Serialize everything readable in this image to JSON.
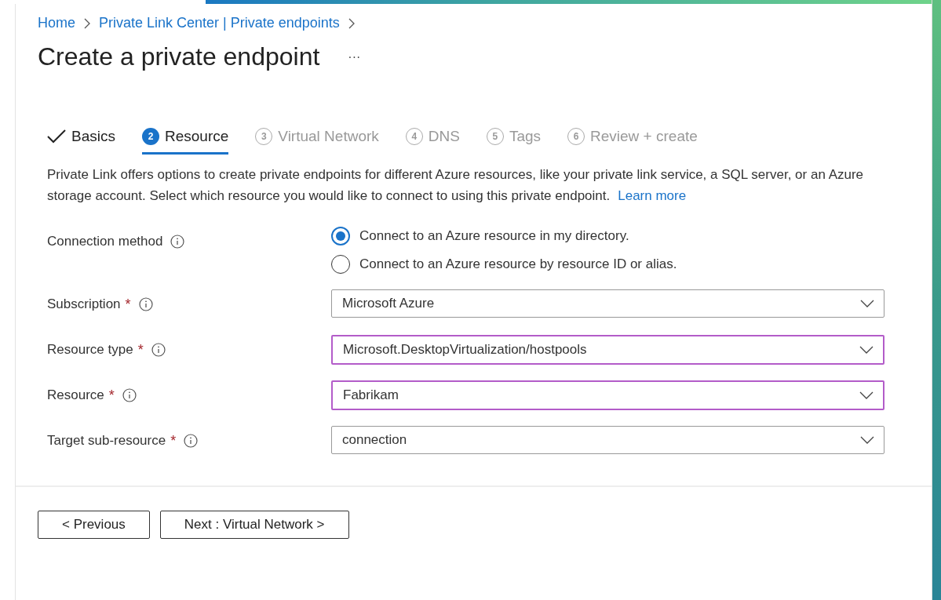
{
  "breadcrumb": [
    {
      "label": "Home"
    },
    {
      "label": "Private Link Center | Private endpoints"
    }
  ],
  "title": "Create a private endpoint",
  "more": "···",
  "tabs": [
    {
      "label": "Basics",
      "completed": true,
      "selected": false
    },
    {
      "number": "2",
      "label": "Resource",
      "completed": false,
      "selected": true
    },
    {
      "number": "3",
      "label": "Virtual Network",
      "completed": false,
      "selected": false
    },
    {
      "number": "4",
      "label": "DNS",
      "completed": false,
      "selected": false
    },
    {
      "number": "5",
      "label": "Tags",
      "completed": false,
      "selected": false
    },
    {
      "number": "6",
      "label": "Review + create",
      "completed": false,
      "selected": false
    }
  ],
  "description": "Private Link offers options to create private endpoints for different Azure resources, like your private link service, a SQL server, or an Azure storage account. Select which resource you would like to connect to using this private endpoint.",
  "learn_more": "Learn more",
  "connection_method": {
    "label": "Connection method",
    "options": [
      {
        "label": "Connect to an Azure resource in my directory.",
        "selected": true
      },
      {
        "label": "Connect to an Azure resource by resource ID or alias.",
        "selected": false
      }
    ]
  },
  "fields": [
    {
      "label": "Subscription",
      "required_mark": "*",
      "value": "Microsoft Azure",
      "highlighted": false
    },
    {
      "label": "Resource type",
      "required_mark": "*",
      "value": "Microsoft.DesktopVirtualization/hostpools",
      "highlighted": true
    },
    {
      "label": "Resource",
      "required_mark": "*",
      "value": "Fabrikam",
      "highlighted": true
    },
    {
      "label": "Target sub-resource",
      "required_mark": "*",
      "value": "connection",
      "highlighted": false
    }
  ],
  "buttons": [
    {
      "label": "< Previous"
    },
    {
      "label": "Next : Virtual Network >"
    }
  ]
}
